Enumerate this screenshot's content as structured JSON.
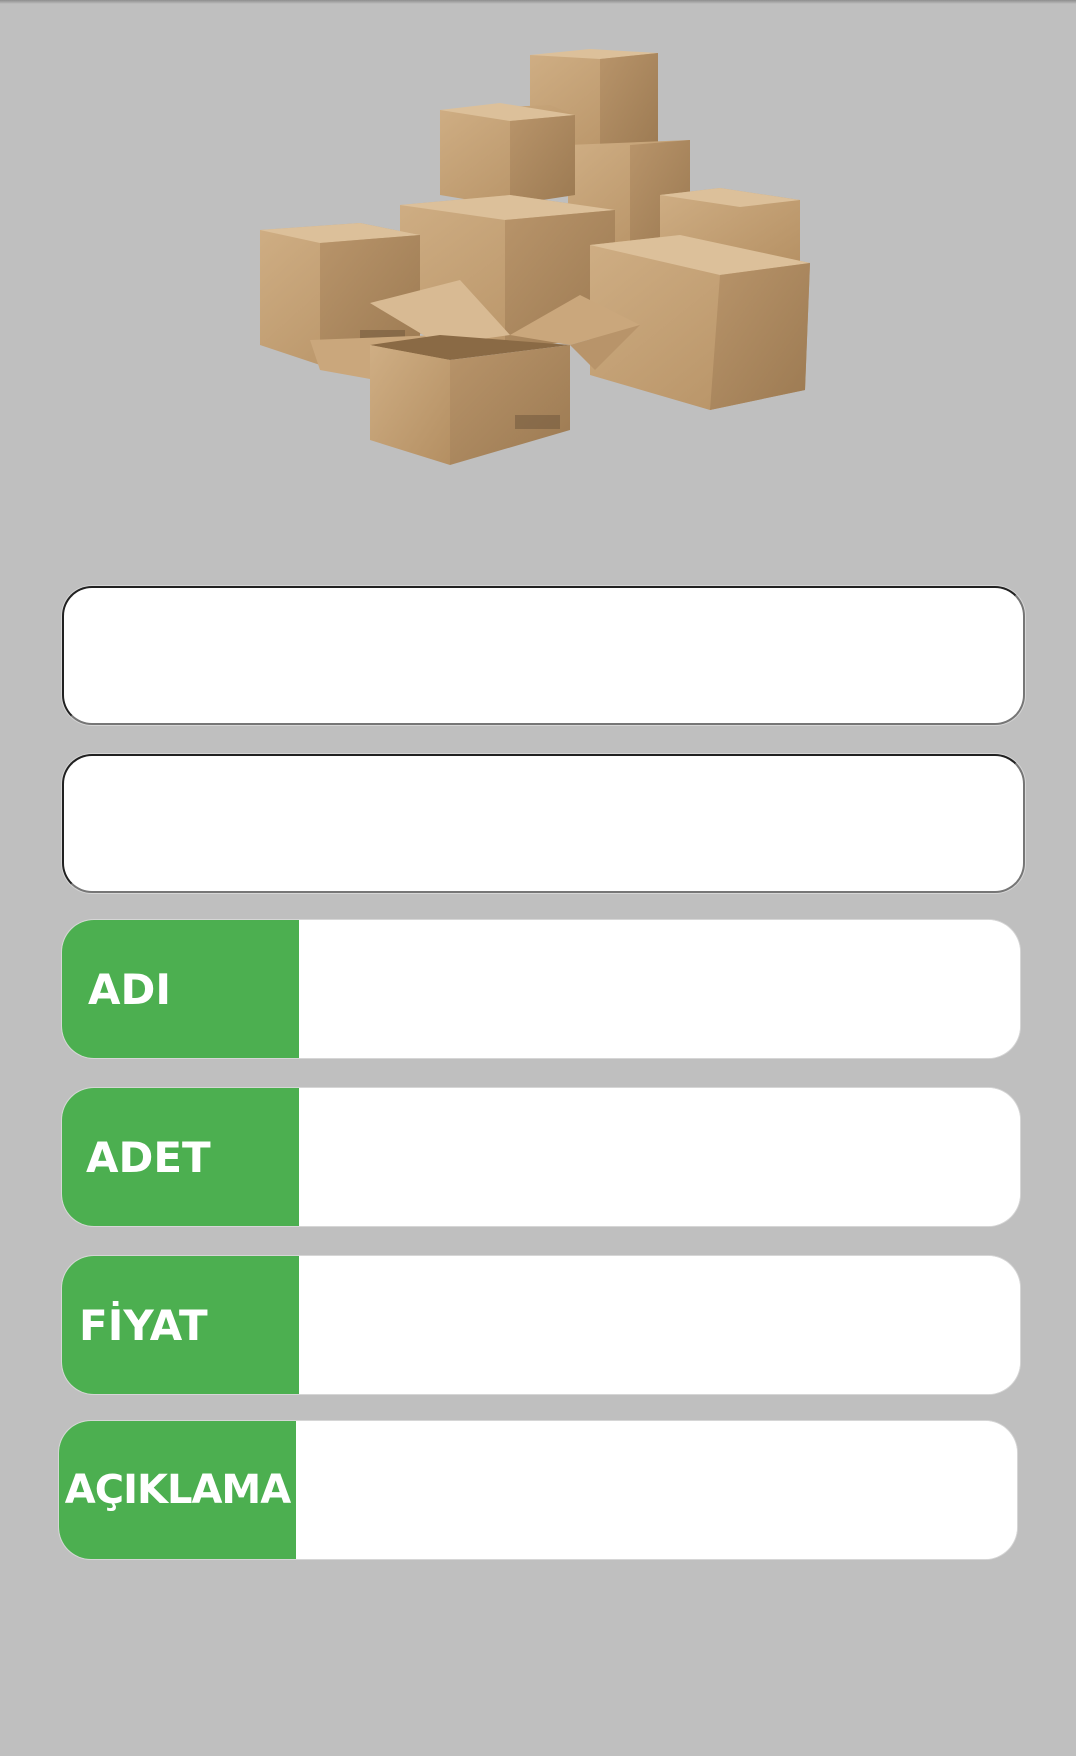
{
  "product_image": {
    "icon": "cardboard-boxes-image"
  },
  "blank_fields": [
    {
      "value": ""
    },
    {
      "value": ""
    }
  ],
  "form": {
    "rows": [
      {
        "label": "ADI",
        "value": ""
      },
      {
        "label": "ADET",
        "value": ""
      },
      {
        "label": "FİYAT",
        "value": ""
      },
      {
        "label": "AÇIKLAMA",
        "value": ""
      }
    ]
  },
  "colors": {
    "background": "#bfbfbf",
    "label_green": "#4caf50",
    "field_white": "#ffffff",
    "box_cardboard": "#c4a175"
  }
}
